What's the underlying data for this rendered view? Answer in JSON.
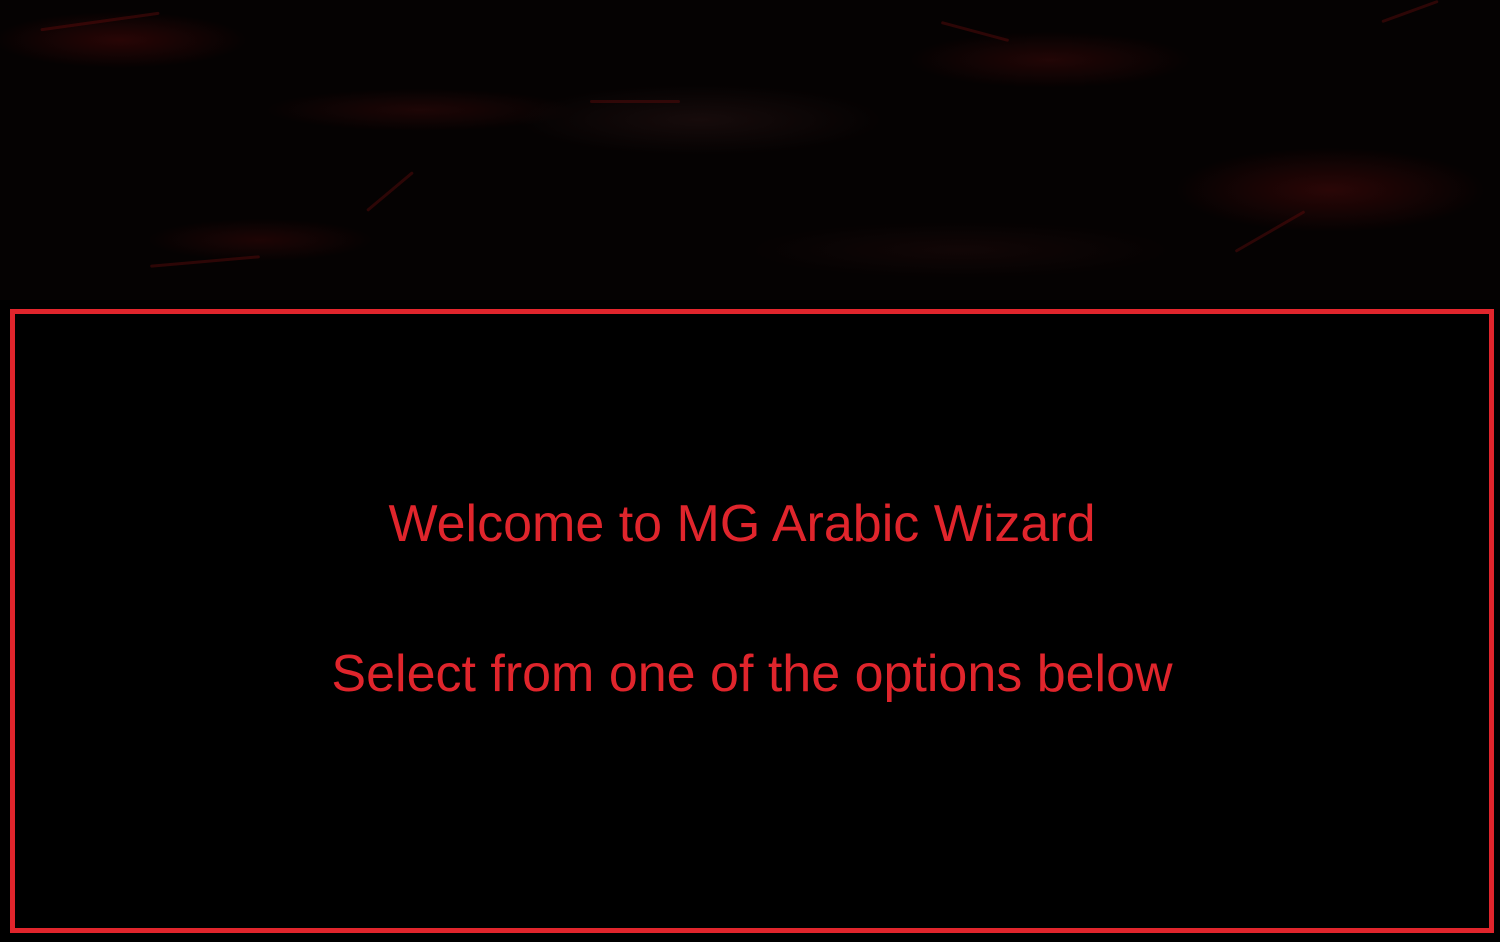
{
  "dialog": {
    "welcome": "Welcome to MG Arabic Wizard",
    "instruction": "Select from one of the options below"
  },
  "colors": {
    "accent": "#e0252c",
    "background": "#000000"
  }
}
